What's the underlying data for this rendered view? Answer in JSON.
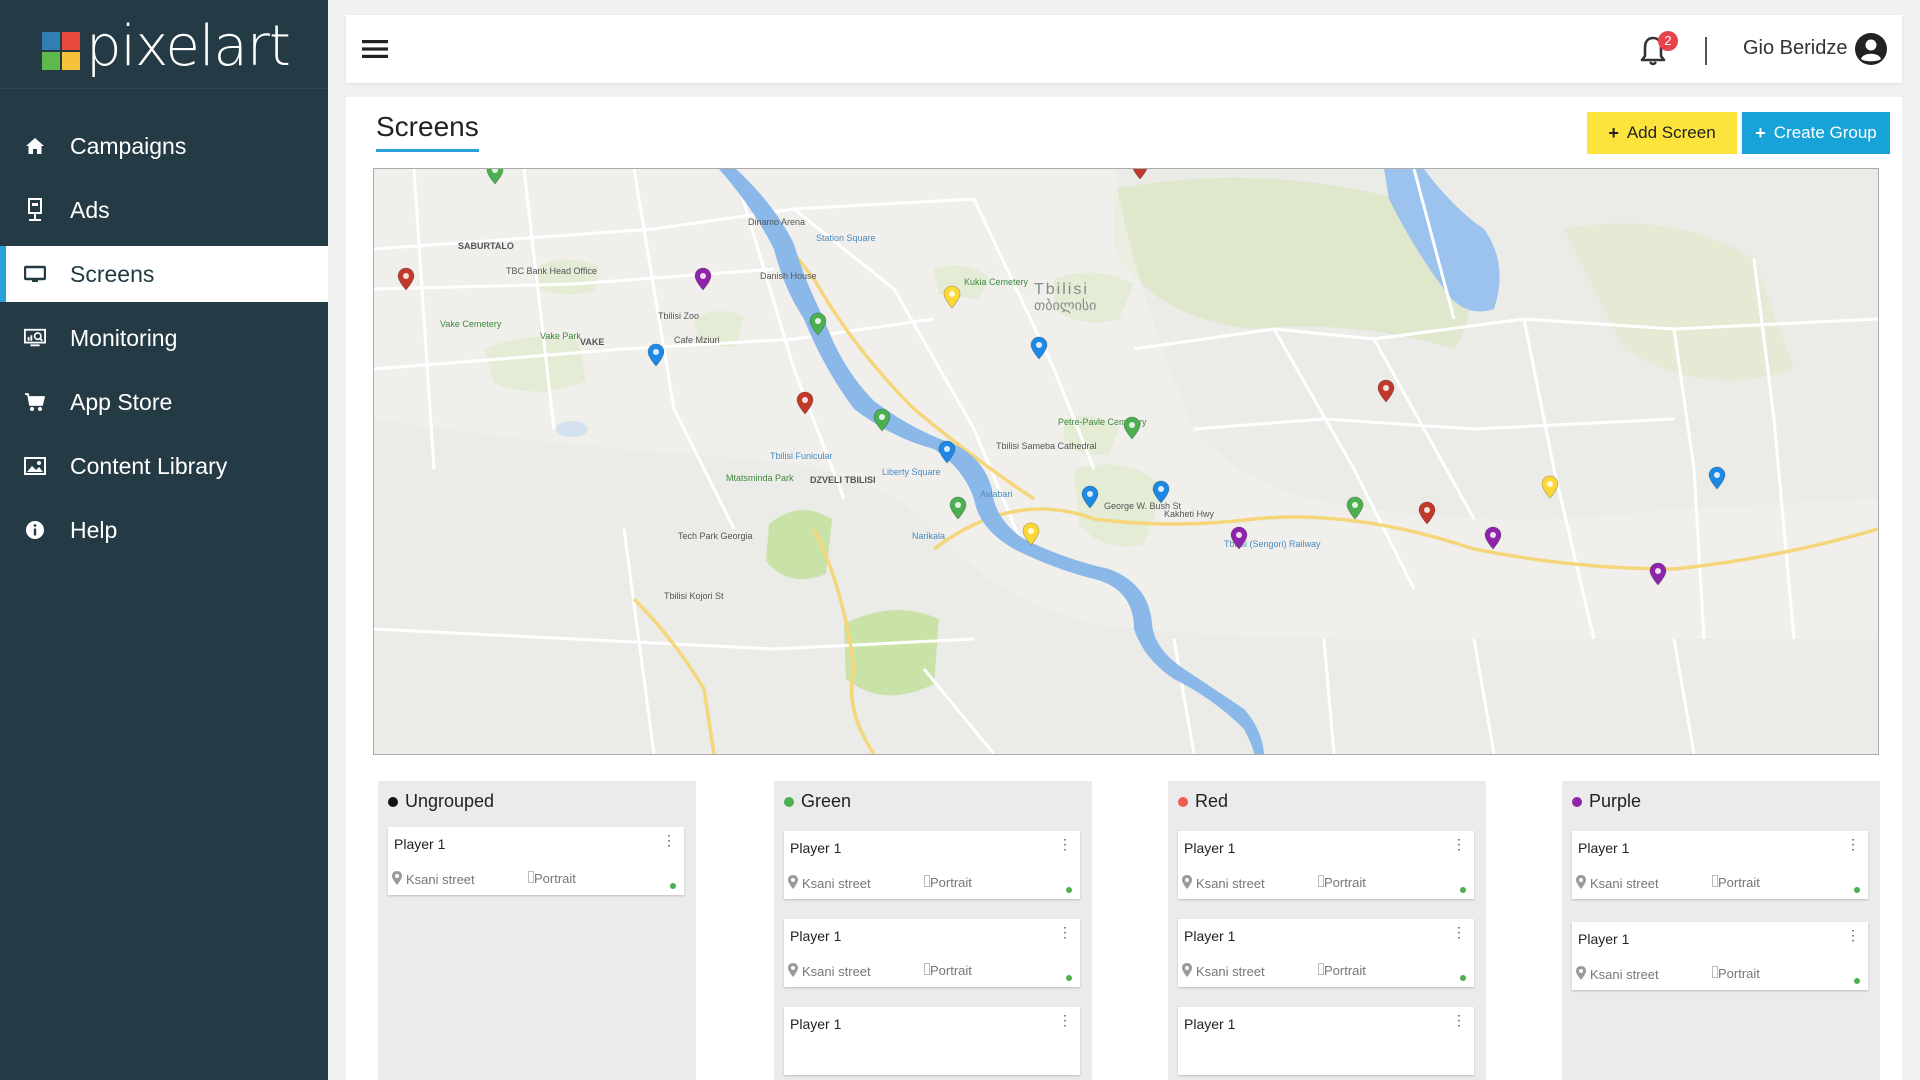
{
  "app": {
    "logo_text": "pixelart"
  },
  "sidebar": {
    "items": [
      {
        "label": "Campaigns",
        "icon": "home-icon"
      },
      {
        "label": "Ads",
        "icon": "kiosk-icon"
      },
      {
        "label": "Screens",
        "icon": "monitor-icon",
        "active": true
      },
      {
        "label": "Monitoring",
        "icon": "monitoring-icon"
      },
      {
        "label": "App Store",
        "icon": "cart-icon"
      },
      {
        "label": "Content Library",
        "icon": "image-icon"
      },
      {
        "label": "Help",
        "icon": "info-icon"
      }
    ]
  },
  "header": {
    "notifications_count": "2",
    "user_name": "Gio Beridze"
  },
  "page": {
    "title": "Screens",
    "add_screen_label": "Add Screen",
    "create_group_label": "Create Group"
  },
  "map": {
    "labels": {
      "city_en": "Tbilisi",
      "city_ka": "თბილისი",
      "saburtalo": "SABURTALO",
      "vake": "VAKE",
      "dzveli": "DZVELI TBILISI",
      "tbc": "TBC Bank Head Office",
      "zoo": "Tbilisi Zoo",
      "cafe": "Cafe Mziuri",
      "danish": "Danish House",
      "dinamo": "Dinamo Arena",
      "kukia": "Kukia Cemetery",
      "vake_cemetery": "Vake Cemetery",
      "vake_park": "Vake Park",
      "peter_paul": "Petre-Pavle Cemetery",
      "sameba": "Tbilisi Sameba Cathedral",
      "techpark": "Tech Park Georgia",
      "funicular": "Tbilisi Funicular",
      "mtatsminda": "Mtatsminda Park",
      "liberty": "Liberty Square",
      "avlabari": "Avlabari",
      "narikala": "Narikala",
      "station_square": "Station Square",
      "railway": "Tbilisi (Sengori) Railway",
      "kakheti": "Kakheti Hwy",
      "bush": "George W. Bush St",
      "kojori": "Tbilisi Kojori St"
    },
    "marker_colors": {
      "green": "#4caf50",
      "red": "#c0392b",
      "blue": "#1e88e5",
      "purple": "#8e24aa",
      "yellow": "#fdd835"
    }
  },
  "groups": [
    {
      "name": "Ungrouped",
      "color": "#111111",
      "cards": [
        {
          "name": "Player 1",
          "location": "Ksani street",
          "orientation": "Portrait"
        }
      ]
    },
    {
      "name": "Green",
      "color": "#4caf50",
      "cards": [
        {
          "name": "Player 1",
          "location": "Ksani street",
          "orientation": "Portrait"
        },
        {
          "name": "Player 1",
          "location": "Ksani street",
          "orientation": "Portrait"
        },
        {
          "name": "Player 1"
        }
      ]
    },
    {
      "name": "Red",
      "color": "#f05a4f",
      "cards": [
        {
          "name": "Player 1",
          "location": "Ksani street",
          "orientation": "Portrait"
        },
        {
          "name": "Player 1",
          "location": "Ksani street",
          "orientation": "Portrait"
        },
        {
          "name": "Player 1"
        }
      ]
    },
    {
      "name": "Purple",
      "color": "#8e24aa",
      "cards": [
        {
          "name": "Player 1",
          "location": "Ksani street",
          "orientation": "Portrait"
        },
        {
          "name": "Player 1",
          "location": "Ksani street",
          "orientation": "Portrait"
        }
      ]
    }
  ]
}
